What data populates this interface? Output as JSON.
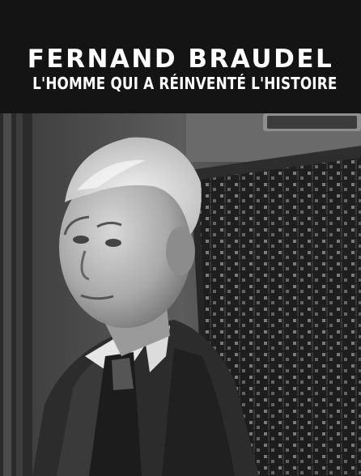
{
  "poster": {
    "title": "FERNAND BRAUDEL",
    "subtitle": "L'HOMME QUI A RÉINVENTÉ L'HISTOIRE"
  },
  "photo": {
    "style": "black-and-white",
    "subject": "portrait"
  },
  "colors": {
    "background": "#141414",
    "title_text": "#ffffff"
  }
}
